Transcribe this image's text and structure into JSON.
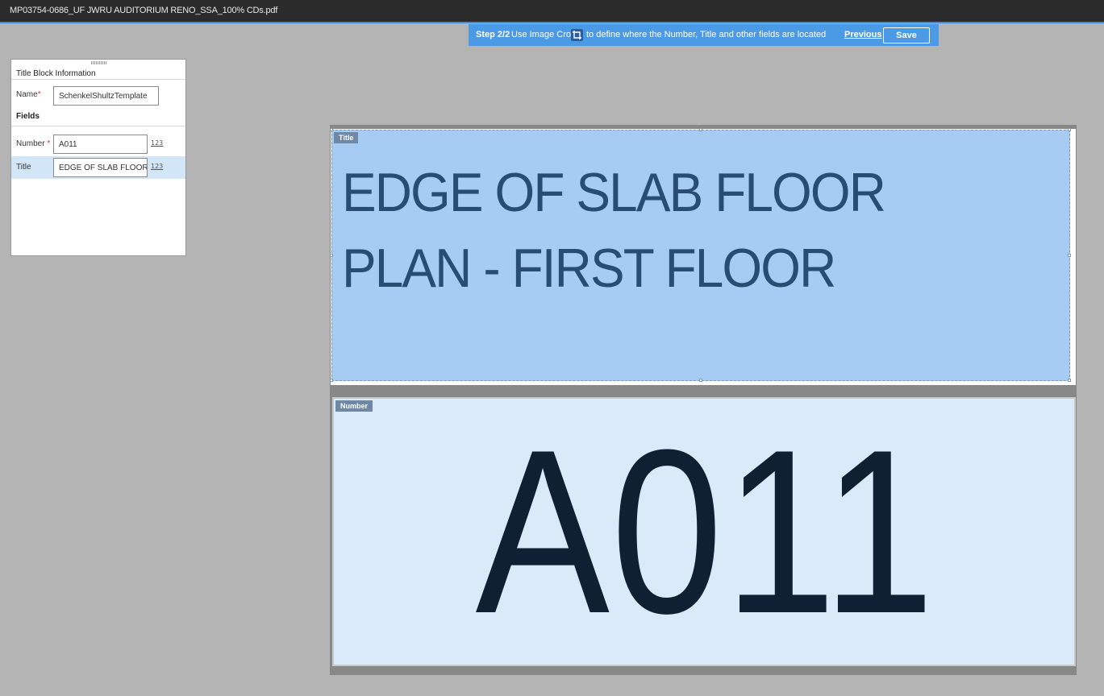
{
  "window": {
    "file_title": "MP03754-0686_UF JWRU AUDITORIUM RENO_SSA_100% CDs.pdf"
  },
  "stepbar": {
    "step": "Step 2/2",
    "instruction_before_icon": "Use Image Crop",
    "instruction_after_icon": "to define where the Number, Title and other fields are located",
    "previous_label": "Previous",
    "save_label": "Save"
  },
  "panel": {
    "header": "Title Block Information",
    "name_label": "Name",
    "name_required_mark": "*",
    "name_value": "SchenkelShultzTemplate",
    "fields_heading": "Fields",
    "fields": [
      {
        "label": "Number",
        "required_mark": "*",
        "value": "A011",
        "icon": "123"
      },
      {
        "label": "Title",
        "required_mark": "",
        "value": "EDGE OF SLAB FLOOR ...",
        "icon": "123"
      }
    ]
  },
  "canvas": {
    "title_region": {
      "tag": "Title",
      "text": "EDGE OF SLAB FLOOR PLAN - FIRST FLOOR"
    },
    "number_region": {
      "tag": "Number",
      "text": "A011"
    }
  },
  "colors": {
    "accent": "#4b9ae6",
    "title_highlight": "#a6ccf3",
    "number_highlight": "#daeaf9",
    "selected_row": "#d3e6f7"
  }
}
